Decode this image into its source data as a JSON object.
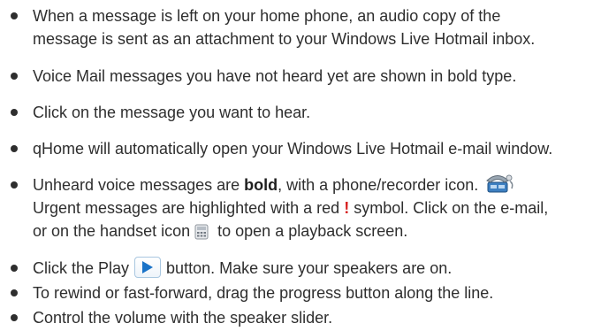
{
  "bullets": [
    {
      "line1": "When a message is left on your home phone, an audio copy of the",
      "line2": "message is sent as an attachment to your Windows Live Hotmail inbox."
    },
    {
      "text": "Voice Mail messages you have not heard yet are shown in bold type."
    },
    {
      "text": "Click on the message you want to hear."
    },
    {
      "text": "qHome will automatically open your Windows Live Hotmail e-mail window."
    },
    {
      "l1_before": "Unheard voice messages are ",
      "l1_bold": "bold",
      "l1_after": ", with a phone/recorder icon.",
      "l2_before": "Urgent messages are highlighted with a red ",
      "l2_symbol": "!",
      "l2_after": " symbol. Click on the e-mail,",
      "l3_before": "or on the handset icon",
      "l3_after": " to open a playback screen."
    },
    {
      "before": "Click the Play",
      "after": "button. Make sure your speakers are on."
    },
    {
      "text": "To rewind or fast-forward, drag the progress button along the line."
    },
    {
      "text": "Control the volume with the speaker slider."
    }
  ],
  "icons": {
    "phone_recorder": "phone-recorder-icon",
    "handset": "handset-icon",
    "play": "play-icon"
  },
  "colors": {
    "text": "#2e2e2e",
    "urgent_red": "#d71e1e",
    "play_blue": "#1a73c8"
  }
}
